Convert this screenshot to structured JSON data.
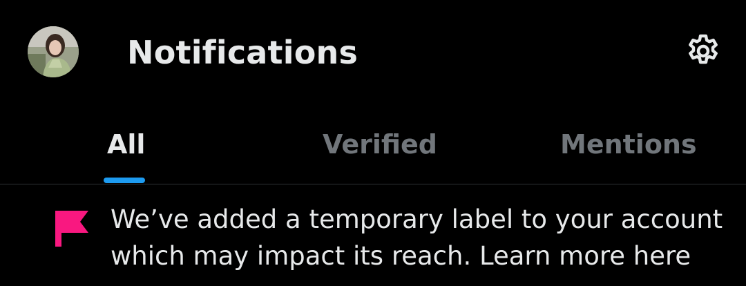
{
  "header": {
    "title": "Notifications",
    "avatar_icon": "profile-avatar",
    "settings_icon": "gear-icon"
  },
  "tabs": [
    {
      "label": "All",
      "active": true
    },
    {
      "label": "Verified",
      "active": false
    },
    {
      "label": "Mentions",
      "active": false
    }
  ],
  "notice": {
    "icon": "flag-icon",
    "text": "We’ve added a temporary label to your account which may impact its reach. Learn more here"
  },
  "colors": {
    "background": "#000000",
    "text_primary": "#e7e9ea",
    "text_secondary": "#71767b",
    "accent": "#1d9bf0",
    "flag": "#f91880",
    "divider": "#2f3336"
  }
}
